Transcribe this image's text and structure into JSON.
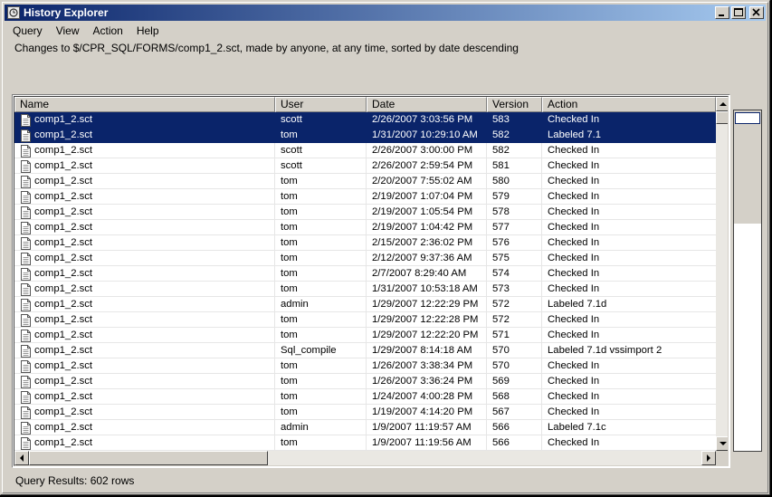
{
  "window": {
    "title": "History Explorer"
  },
  "menu": [
    "Query",
    "View",
    "Action",
    "Help"
  ],
  "query_description": "Changes to $/CPR_SQL/FORMS/comp1_2.sct, made by anyone, at any time, sorted by date descending",
  "columns": [
    "Name",
    "User",
    "Date",
    "Version",
    "Action"
  ],
  "rows": [
    {
      "name": "comp1_2.sct",
      "user": "scott",
      "date": "2/26/2007 3:03:56 PM",
      "version": "583",
      "action": "Checked In",
      "selected": true
    },
    {
      "name": "comp1_2.sct",
      "user": "tom",
      "date": "1/31/2007 10:29:10 AM",
      "version": "582",
      "action": "Labeled 7.1",
      "selected": true
    },
    {
      "name": "comp1_2.sct",
      "user": "scott",
      "date": "2/26/2007 3:00:00 PM",
      "version": "582",
      "action": "Checked In",
      "selected": false
    },
    {
      "name": "comp1_2.sct",
      "user": "scott",
      "date": "2/26/2007 2:59:54 PM",
      "version": "581",
      "action": "Checked In",
      "selected": false
    },
    {
      "name": "comp1_2.sct",
      "user": "tom",
      "date": "2/20/2007 7:55:02 AM",
      "version": "580",
      "action": "Checked In",
      "selected": false
    },
    {
      "name": "comp1_2.sct",
      "user": "tom",
      "date": "2/19/2007 1:07:04 PM",
      "version": "579",
      "action": "Checked In",
      "selected": false
    },
    {
      "name": "comp1_2.sct",
      "user": "tom",
      "date": "2/19/2007 1:05:54 PM",
      "version": "578",
      "action": "Checked In",
      "selected": false
    },
    {
      "name": "comp1_2.sct",
      "user": "tom",
      "date": "2/19/2007 1:04:42 PM",
      "version": "577",
      "action": "Checked In",
      "selected": false
    },
    {
      "name": "comp1_2.sct",
      "user": "tom",
      "date": "2/15/2007 2:36:02 PM",
      "version": "576",
      "action": "Checked In",
      "selected": false
    },
    {
      "name": "comp1_2.sct",
      "user": "tom",
      "date": "2/12/2007 9:37:36 AM",
      "version": "575",
      "action": "Checked In",
      "selected": false
    },
    {
      "name": "comp1_2.sct",
      "user": "tom",
      "date": "2/7/2007 8:29:40 AM",
      "version": "574",
      "action": "Checked In",
      "selected": false
    },
    {
      "name": "comp1_2.sct",
      "user": "tom",
      "date": "1/31/2007 10:53:18 AM",
      "version": "573",
      "action": "Checked In",
      "selected": false
    },
    {
      "name": "comp1_2.sct",
      "user": "admin",
      "date": "1/29/2007 12:22:29 PM",
      "version": "572",
      "action": "Labeled 7.1d",
      "selected": false
    },
    {
      "name": "comp1_2.sct",
      "user": "tom",
      "date": "1/29/2007 12:22:28 PM",
      "version": "572",
      "action": "Checked In",
      "selected": false
    },
    {
      "name": "comp1_2.sct",
      "user": "tom",
      "date": "1/29/2007 12:22:20 PM",
      "version": "571",
      "action": "Checked In",
      "selected": false
    },
    {
      "name": "comp1_2.sct",
      "user": "Sql_compile",
      "date": "1/29/2007 8:14:18 AM",
      "version": "570",
      "action": "Labeled 7.1d vssimport 2",
      "selected": false
    },
    {
      "name": "comp1_2.sct",
      "user": "tom",
      "date": "1/26/2007 3:38:34 PM",
      "version": "570",
      "action": "Checked In",
      "selected": false
    },
    {
      "name": "comp1_2.sct",
      "user": "tom",
      "date": "1/26/2007 3:36:24 PM",
      "version": "569",
      "action": "Checked In",
      "selected": false
    },
    {
      "name": "comp1_2.sct",
      "user": "tom",
      "date": "1/24/2007 4:00:28 PM",
      "version": "568",
      "action": "Checked In",
      "selected": false
    },
    {
      "name": "comp1_2.sct",
      "user": "tom",
      "date": "1/19/2007 4:14:20 PM",
      "version": "567",
      "action": "Checked In",
      "selected": false
    },
    {
      "name": "comp1_2.sct",
      "user": "admin",
      "date": "1/9/2007 11:19:57 AM",
      "version": "566",
      "action": "Labeled 7.1c",
      "selected": false
    },
    {
      "name": "comp1_2.sct",
      "user": "tom",
      "date": "1/9/2007 11:19:56 AM",
      "version": "566",
      "action": "Checked In",
      "selected": false
    }
  ],
  "status": {
    "results": "Query Results: 602 rows"
  }
}
